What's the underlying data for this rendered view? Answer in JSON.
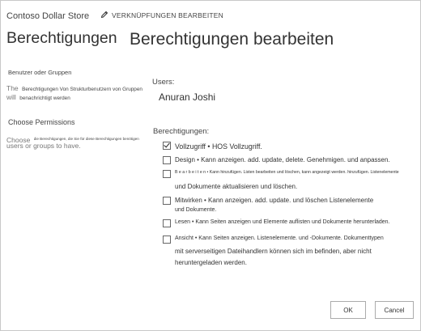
{
  "header": {
    "site_title": "Contoso Dollar Store",
    "edit_links": "VERKNÜPFUNGEN BEARBEITEN",
    "page_title": "Berechtigungen",
    "page_subtitle": "Berechtigungen bearbeiten"
  },
  "users_section": {
    "heading": "Benutzer oder Gruppen",
    "desc_lead": "The",
    "desc_small": "Berechtigungen Von Strukturbenutzern von Gruppen",
    "desc_line2_lead": "will",
    "desc_line2_small": "benachrichtigt werden",
    "users_label": "Users:",
    "user_name": "Anuran Joshi"
  },
  "permissions_section": {
    "heading": "Choose Permissions",
    "desc_lead": "Choose",
    "desc_small": "die Berechtigungen, die Sie für diese Berechtigungen benötigen",
    "desc_line2": "users or groups to have.",
    "label": "Berechtigungen:",
    "options": [
      {
        "checked": true,
        "text": "Vollzugriff • HOS Vollzugriff."
      },
      {
        "checked": false,
        "text": "Design • Kann anzeigen. add. update, delete. Genehmigen. und anpassen."
      },
      {
        "checked": false,
        "text": "B e a r b e i t e n • Kann hinzufügen. Listen bearbeiten und löschen, kann angezeigt werden. hinzufügen. Listenelemente",
        "text2": "und Dokumente aktualisieren und löschen."
      },
      {
        "checked": false,
        "text": "Mitwirken • Kann anzeigen. add. update. und löschen Listenelemente",
        "text2": "und Dokumente."
      },
      {
        "checked": false,
        "text": "Lesen • Kann Seiten anzeigen und Elemente auflisten und Dokumente herunterladen."
      },
      {
        "checked": false,
        "text": "Ansicht • Kann Seiten anzeigen. Listenelemente. und -Dokumente. Dokumenttypen",
        "text2": "mit serverseitigen Dateihandlern können sich im befinden, aber nicht",
        "text3": "heruntergeladen werden."
      }
    ]
  },
  "buttons": {
    "ok": "OK",
    "cancel": "Cancel"
  }
}
